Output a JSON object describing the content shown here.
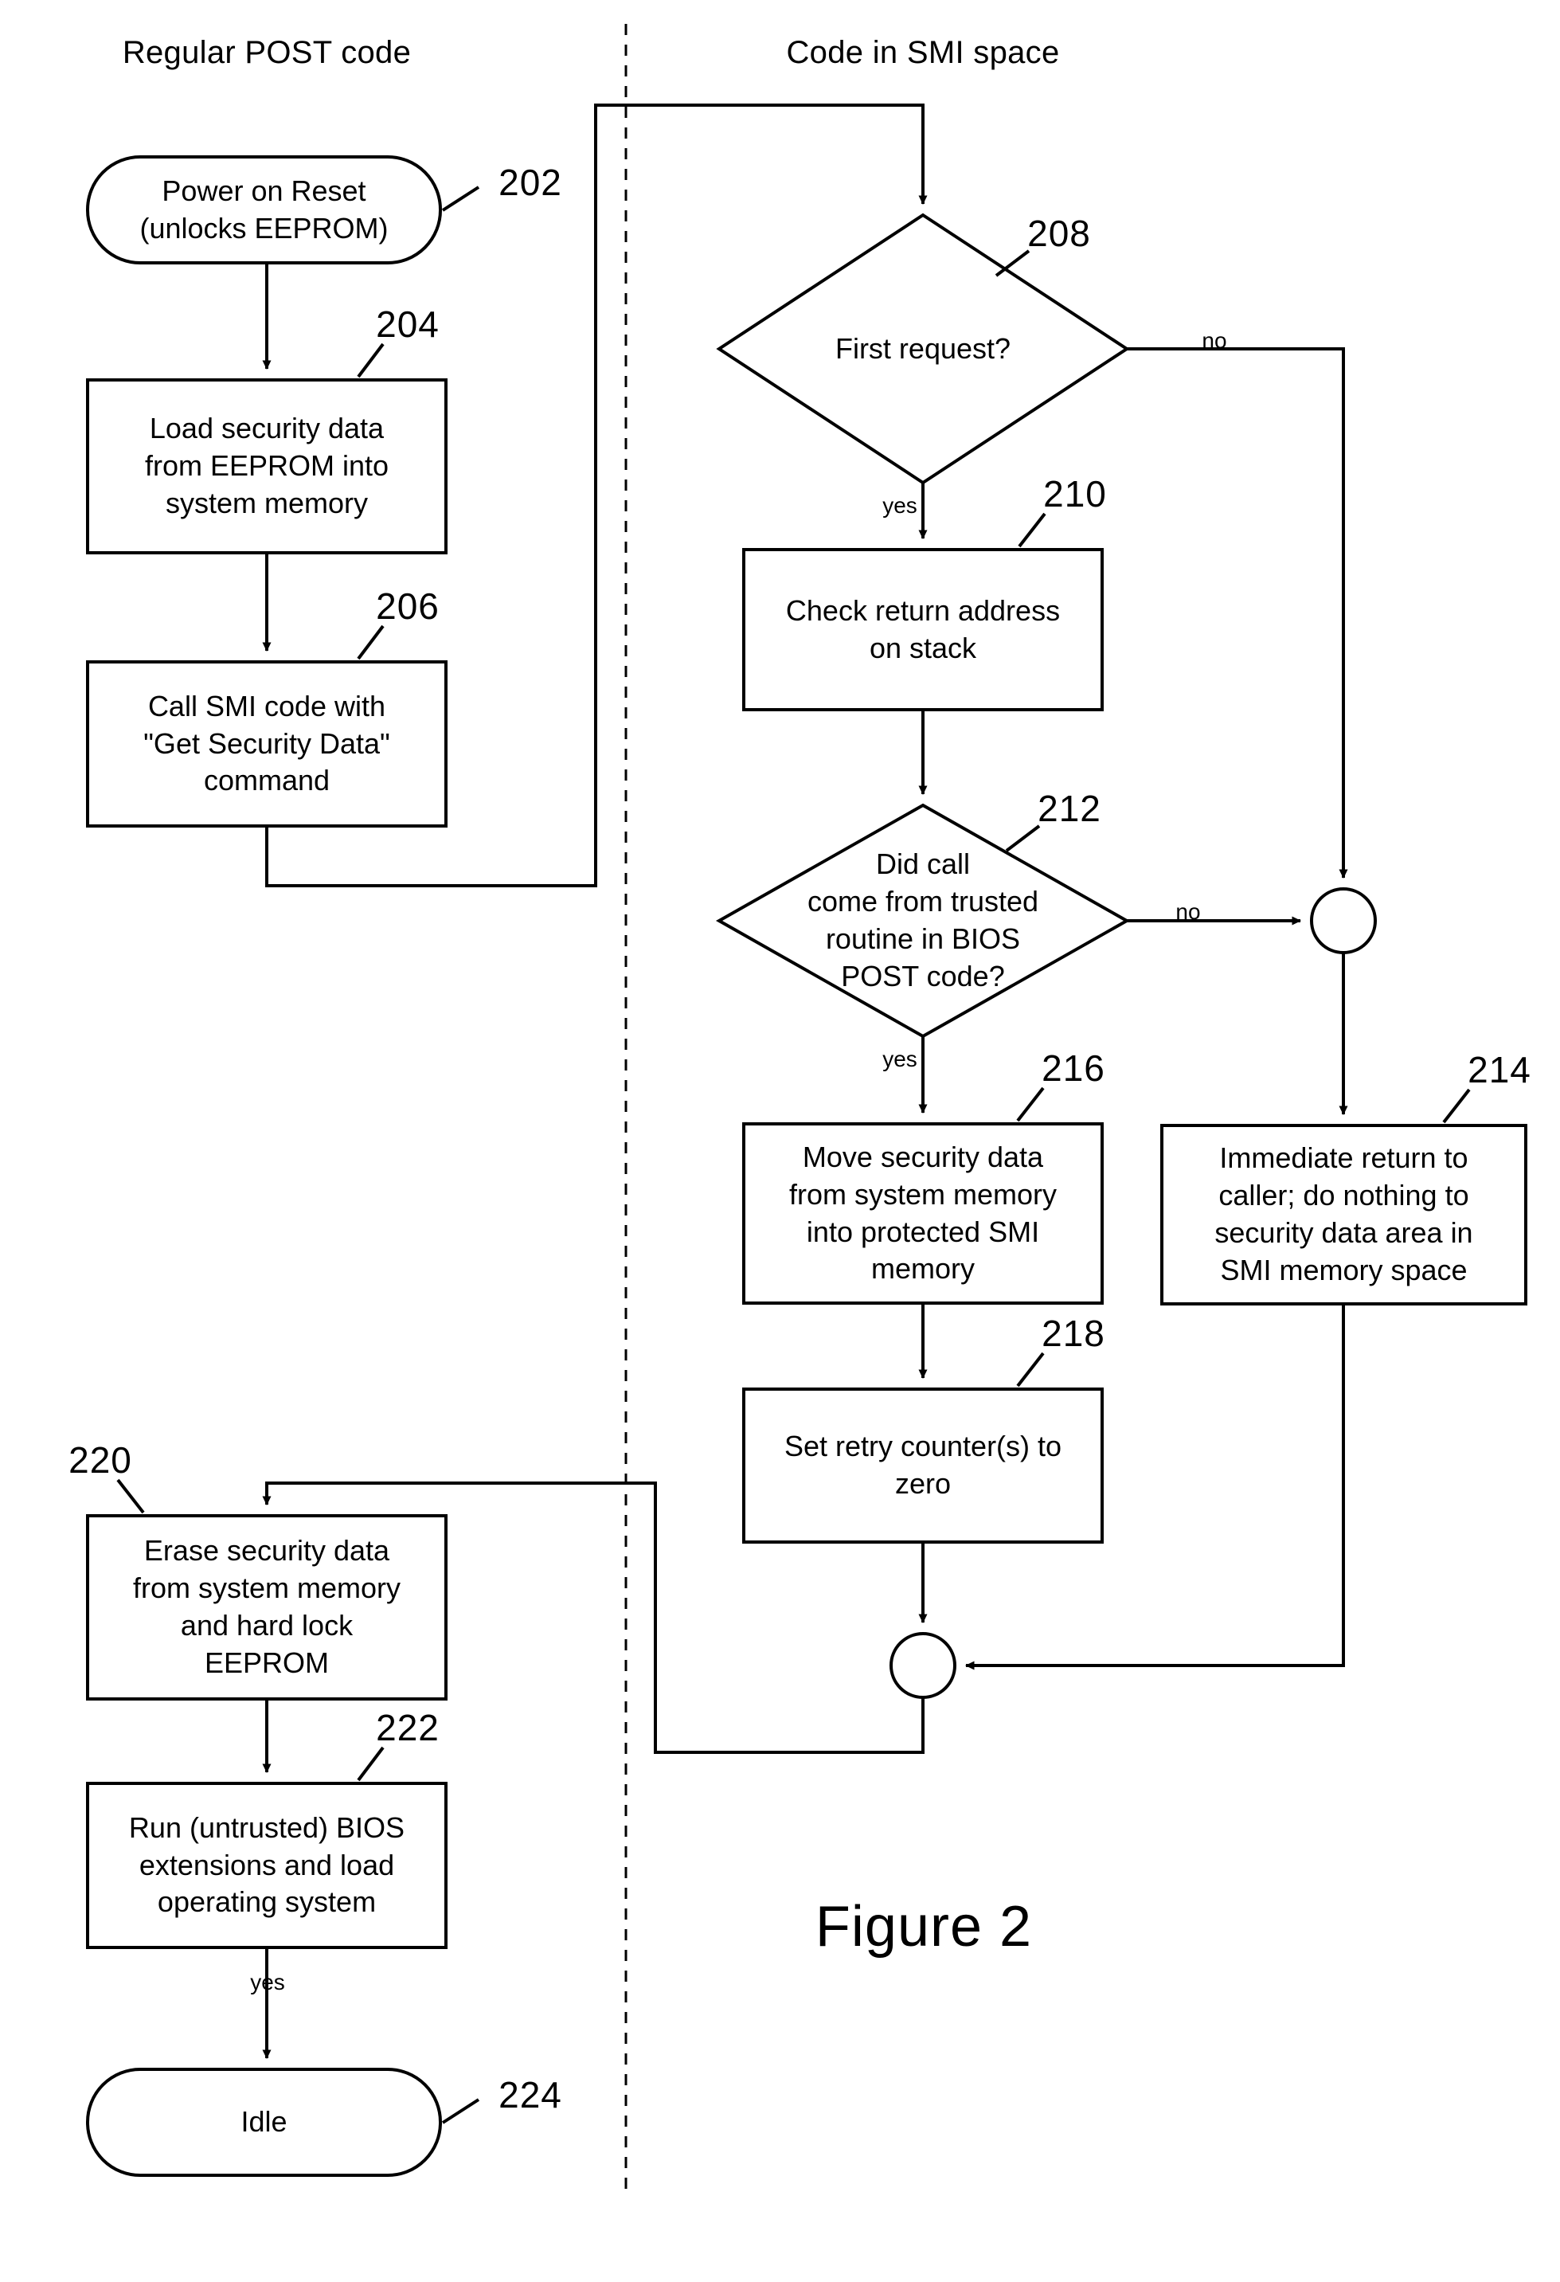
{
  "figure": {
    "caption": "Figure 2",
    "columns": [
      {
        "id": "left",
        "title": "Regular POST code"
      },
      {
        "id": "right",
        "title": "Code in SMI space"
      }
    ]
  },
  "nodes": [
    {
      "ref": "202",
      "shape": "terminator",
      "column": "left",
      "text": "Power on Reset\n(unlocks EEPROM)"
    },
    {
      "ref": "204",
      "shape": "process",
      "column": "left",
      "text": "Load security data\nfrom EEPROM into\nsystem memory"
    },
    {
      "ref": "206",
      "shape": "process",
      "column": "left",
      "text": "Call SMI code with\n\"Get Security Data\"\ncommand"
    },
    {
      "ref": "208",
      "shape": "decision",
      "column": "right",
      "text": "First request?"
    },
    {
      "ref": "210",
      "shape": "process",
      "column": "right",
      "text": "Check return address\non stack"
    },
    {
      "ref": "212",
      "shape": "decision",
      "column": "right",
      "text": "Did call\ncome from trusted\nroutine in BIOS\nPOST code?"
    },
    {
      "ref": "214",
      "shape": "process",
      "column": "right",
      "text": "Immediate return to\ncaller; do nothing to\nsecurity data area in\nSMI memory space"
    },
    {
      "ref": "216",
      "shape": "process",
      "column": "right",
      "text": "Move security data\nfrom system memory\ninto protected SMI\nmemory"
    },
    {
      "ref": "218",
      "shape": "process",
      "column": "right",
      "text": "Set retry counter(s) to\nzero"
    },
    {
      "ref": "220",
      "shape": "process",
      "column": "left",
      "text": "Erase security data\nfrom system memory\nand hard lock\nEEPROM"
    },
    {
      "ref": "222",
      "shape": "process",
      "column": "left",
      "text": "Run (untrusted) BIOS\nextensions and load\noperating system"
    },
    {
      "ref": "224",
      "shape": "terminator",
      "column": "left",
      "text": "Idle"
    }
  ],
  "connector_labels": {
    "first_request_no": "no",
    "first_request_yes": "yes",
    "trusted_no": "no",
    "trusted_yes": "yes",
    "to_idle_yes": "yes"
  },
  "junctions": [
    {
      "id": "junction-upper-right"
    },
    {
      "id": "junction-lower"
    }
  ],
  "style": {
    "stroke": "#000000",
    "fill": "#ffffff",
    "divider": "dashed"
  }
}
